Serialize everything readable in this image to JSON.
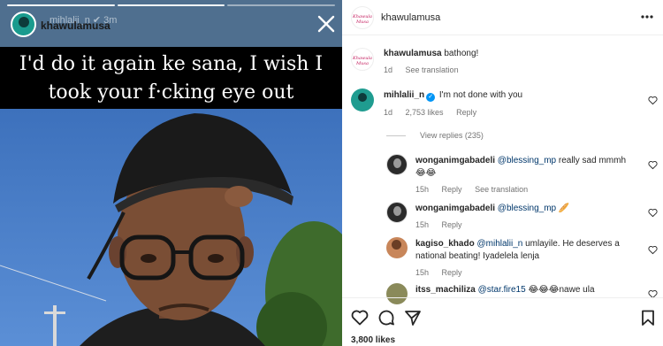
{
  "story": {
    "username": "khawulamusa",
    "ghost_text": "mihlalii_n  ✔  3m",
    "caption_line1": "I'd do it again ke sana, I wish I",
    "caption_line2": "took your f·cking eye out"
  },
  "post": {
    "author": "khawulamusa",
    "caption_user": "khawulamusa",
    "caption_text": "bathong!",
    "caption_time": "1d",
    "see_translation": "See translation",
    "likes": "3,800 likes"
  },
  "comments": [
    {
      "user": "mihlalii_n",
      "verified": true,
      "text": "I'm not done with you",
      "time": "1d",
      "likes": "2,753 likes",
      "reply": "Reply",
      "view_replies": "View replies (235)"
    },
    {
      "user": "wonganimgabadeli",
      "mention": "@blessing_mp",
      "text": "really sad mmmh",
      "emoji": "😂😂",
      "time": "15h",
      "reply": "Reply",
      "see_translation": "See translation"
    },
    {
      "user": "wonganimgabadeli",
      "mention": "@blessing_mp",
      "emoji": "🥖",
      "time": "15h",
      "reply": "Reply"
    },
    {
      "user": "kagiso_khado",
      "mention": "@mihlalii_n",
      "text_line1": "umlayile. He deserves a",
      "text_line2": "national beating! Iyadelela lenja",
      "time": "15h",
      "reply": "Reply"
    },
    {
      "user": "itss_machiliza",
      "mention": "@star.fire15",
      "emoji": "😂😂😂",
      "text": "nawe ula"
    }
  ],
  "colors": {
    "link": "#00376b",
    "verified": "#0095f6",
    "muted": "#737373",
    "story_caption_bg": "#000000"
  },
  "icons": [
    "close-icon",
    "more-icon",
    "heart-icon",
    "comment-icon",
    "share-icon",
    "bookmark-icon",
    "verified-icon"
  ]
}
